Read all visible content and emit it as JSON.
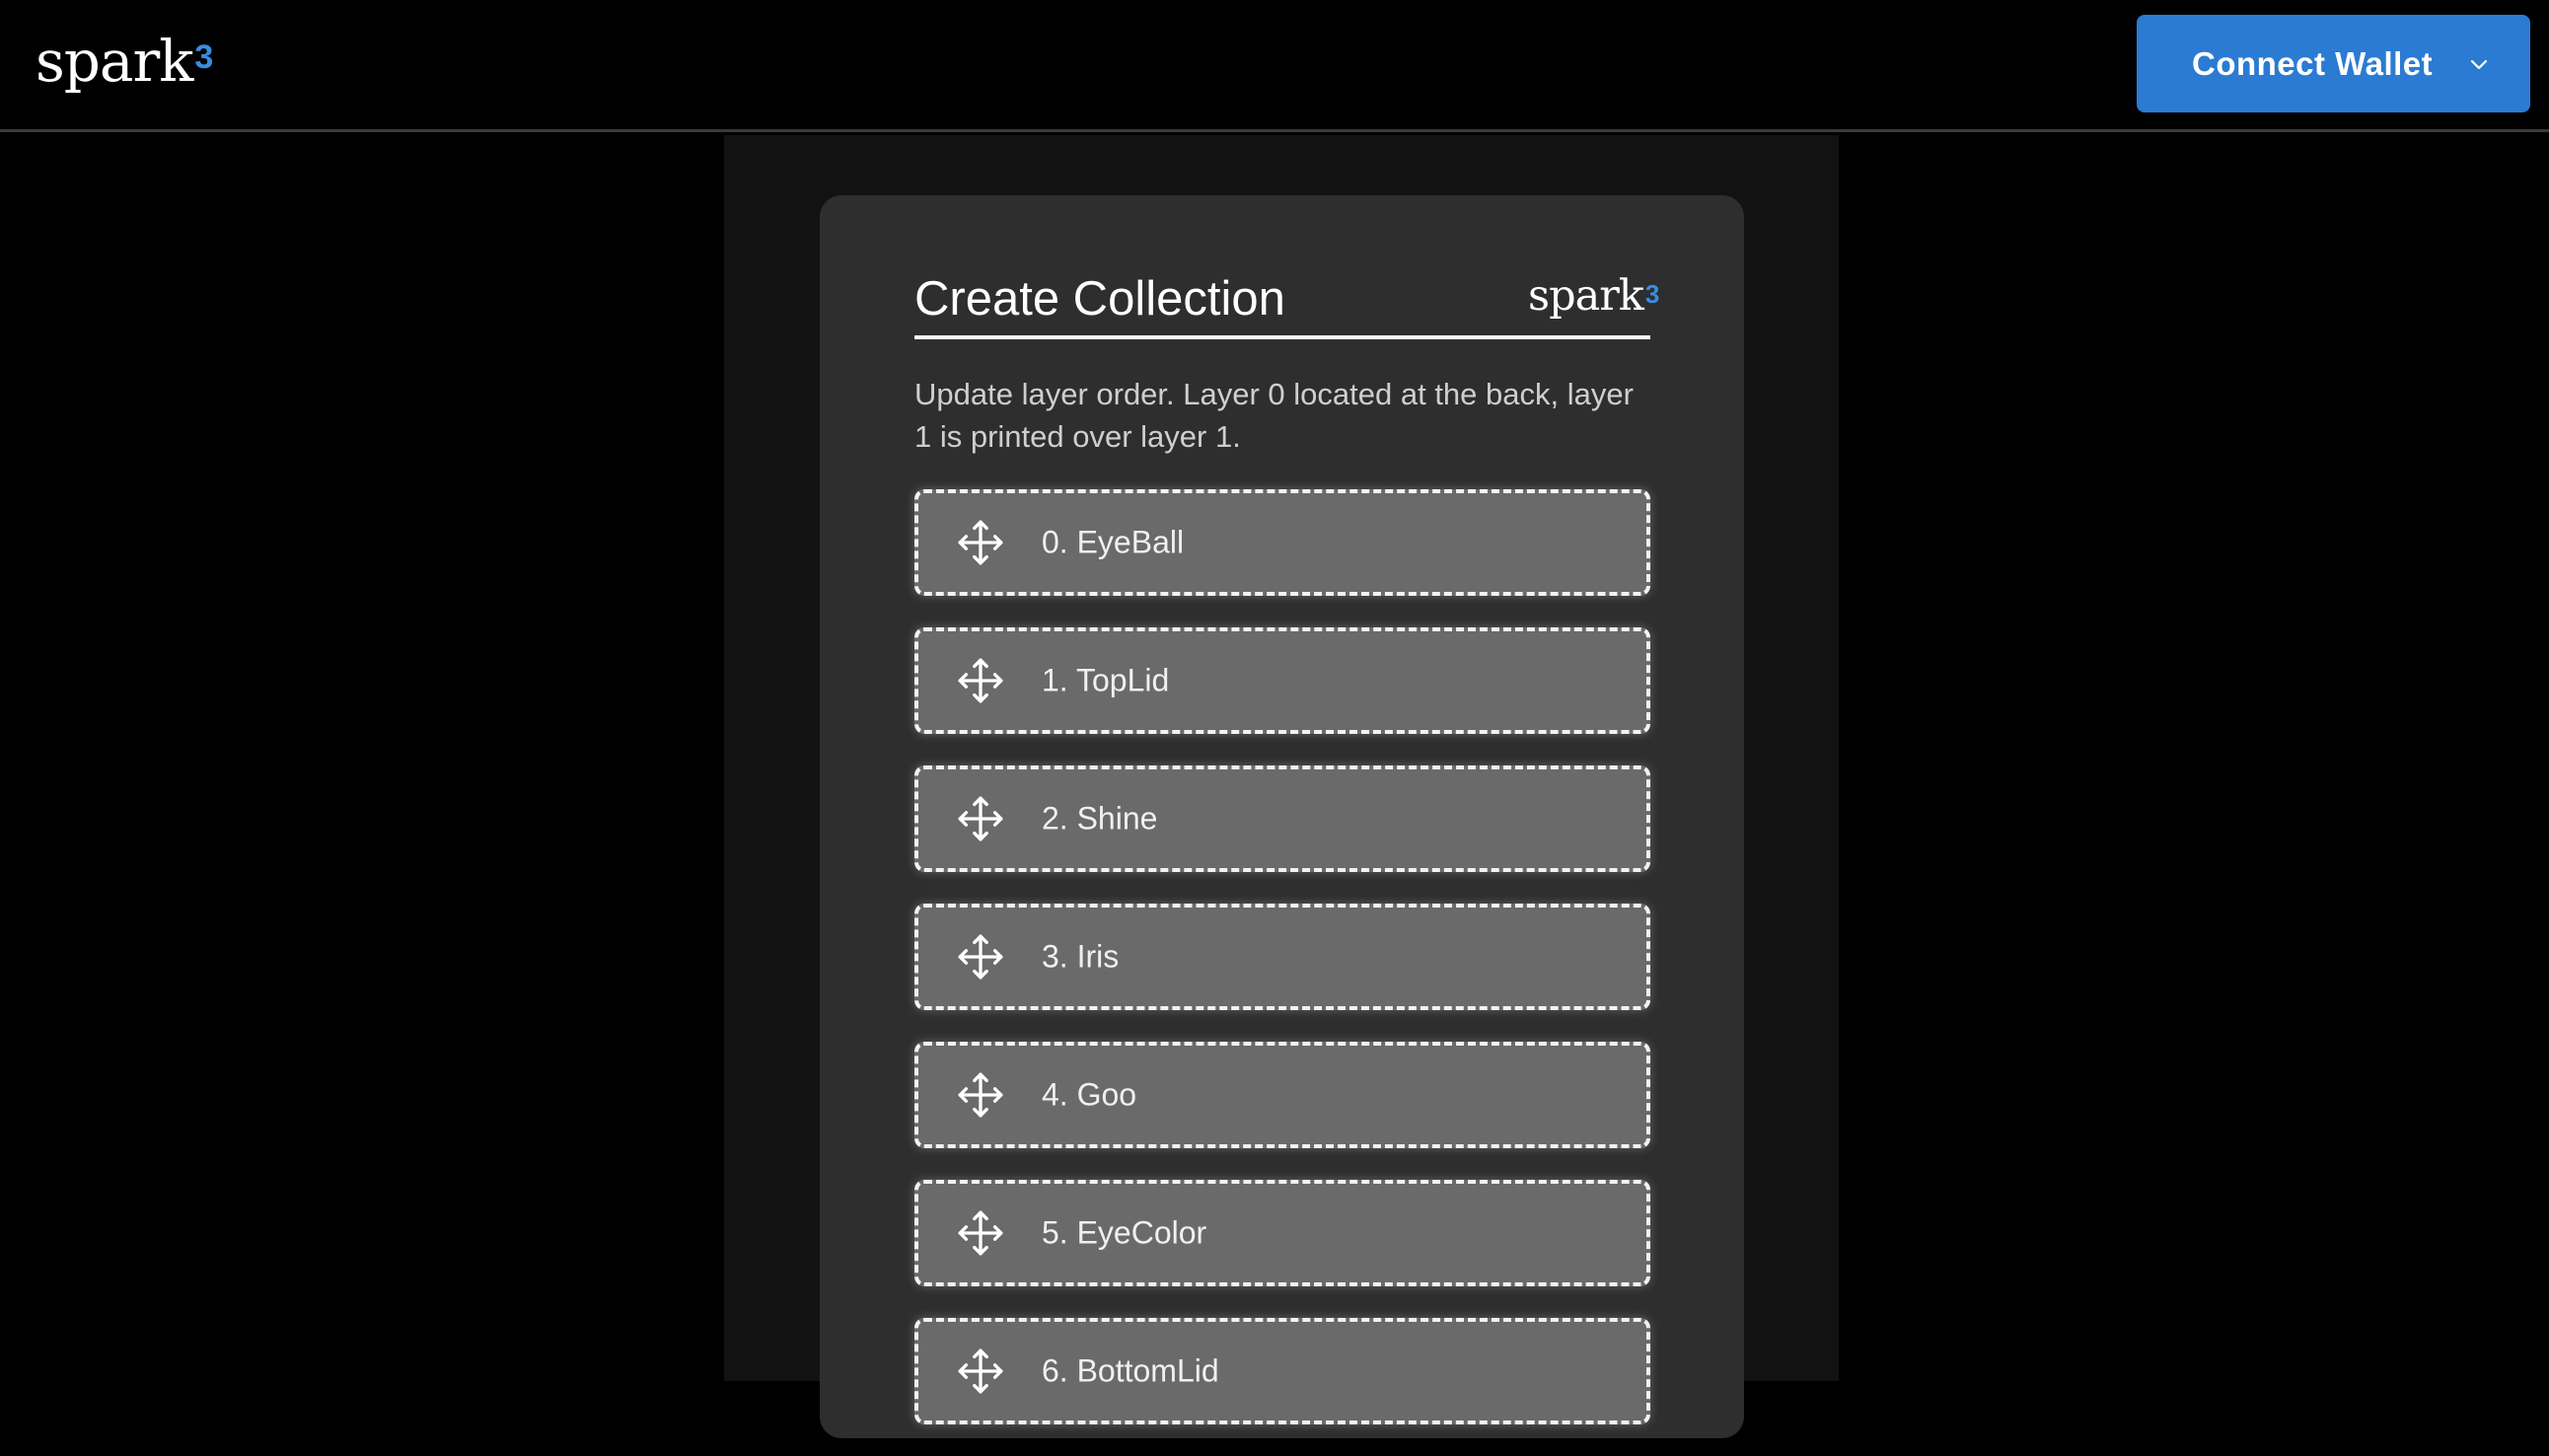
{
  "header": {
    "logo_text": "spark",
    "logo_sup": "3",
    "connect_wallet_label": "Connect Wallet",
    "connect_wallet_icon": "chevron-down-icon"
  },
  "card": {
    "title": "Create Collection",
    "logo_text": "spark",
    "logo_sup": "3",
    "description": "Update layer order. Layer 0 located at the back, layer 1 is printed over layer 1.",
    "layers": [
      {
        "label": "0. EyeBall",
        "icon": "move-icon"
      },
      {
        "label": "1. TopLid",
        "icon": "move-icon"
      },
      {
        "label": "2. Shine",
        "icon": "move-icon"
      },
      {
        "label": "3. Iris",
        "icon": "move-icon"
      },
      {
        "label": "4. Goo",
        "icon": "move-icon"
      },
      {
        "label": "5. EyeColor",
        "icon": "move-icon"
      },
      {
        "label": "6. BottomLid",
        "icon": "move-icon"
      }
    ]
  },
  "colors": {
    "accent": "#2b7bd3",
    "logo_sup": "#3a8de0",
    "card_bg": "#2e2e2e",
    "layer_bg": "#6a6a6a"
  }
}
